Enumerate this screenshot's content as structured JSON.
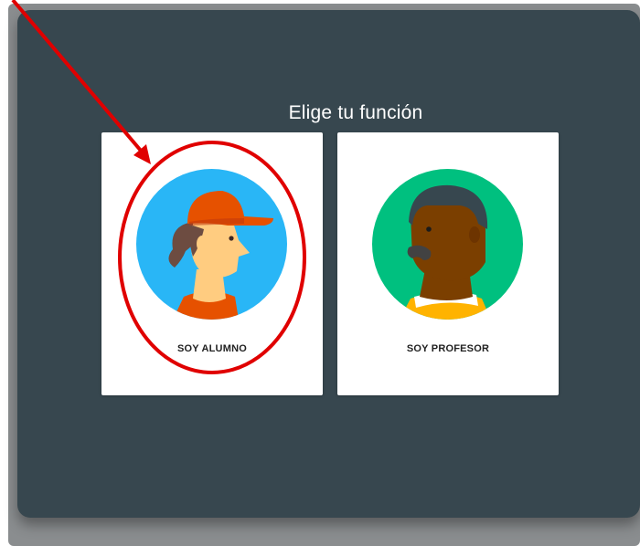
{
  "dialog": {
    "title": "Elige tu función"
  },
  "roles": [
    {
      "label": "SOY ALUMNO",
      "icon": "student-avatar-icon"
    },
    {
      "label": "SOY PROFESOR",
      "icon": "teacher-avatar-icon"
    }
  ],
  "colors": {
    "dialog_bg": "#37474f",
    "card_bg": "#ffffff",
    "annotation": "#e00000",
    "student_circle": "#29b6f6",
    "teacher_circle": "#00c07f"
  }
}
